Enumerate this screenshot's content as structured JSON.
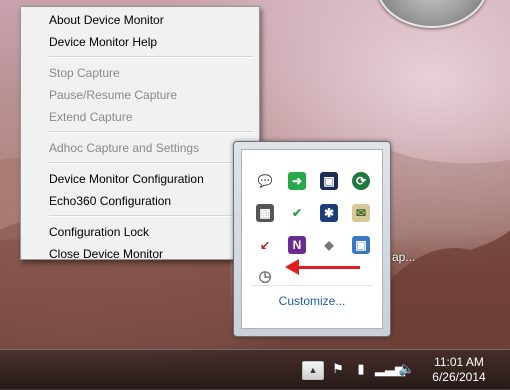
{
  "menu": {
    "groups": [
      [
        {
          "label": "About Device Monitor",
          "enabled": true
        },
        {
          "label": "Device Monitor Help",
          "enabled": true
        }
      ],
      [
        {
          "label": "Stop Capture",
          "enabled": false
        },
        {
          "label": "Pause/Resume Capture",
          "enabled": false
        },
        {
          "label": "Extend Capture",
          "enabled": false
        }
      ],
      [
        {
          "label": "Adhoc Capture and Settings",
          "enabled": false
        }
      ],
      [
        {
          "label": "Device Monitor Configuration",
          "enabled": true
        },
        {
          "label": "Echo360 Configuration",
          "enabled": true
        }
      ],
      [
        {
          "label": "Configuration Lock",
          "enabled": true
        },
        {
          "label": "Close Device Monitor",
          "enabled": true
        }
      ]
    ]
  },
  "flyout": {
    "customize_label": "Customize...",
    "icons": [
      "chat-icon",
      "green-arrow-icon",
      "network-monitor-icon",
      "sync-icon",
      "keyboard-icon",
      "check-shield-icon",
      "bluetooth-icon",
      "mail-icon",
      "usb-icon",
      "onenote-icon",
      "drive-icon",
      "display-icon",
      "device-monitor-icon"
    ]
  },
  "overflow_text": "ap...",
  "taskbar": {
    "icons": [
      "flag-icon",
      "power-icon",
      "signal-icon",
      "volume-icon"
    ],
    "time": "11:01 AM",
    "date": "6/26/2014"
  },
  "colors": {
    "arrow": "#e21d1d",
    "link": "#1e5ea8",
    "disabled_text": "#8a8a8a"
  }
}
